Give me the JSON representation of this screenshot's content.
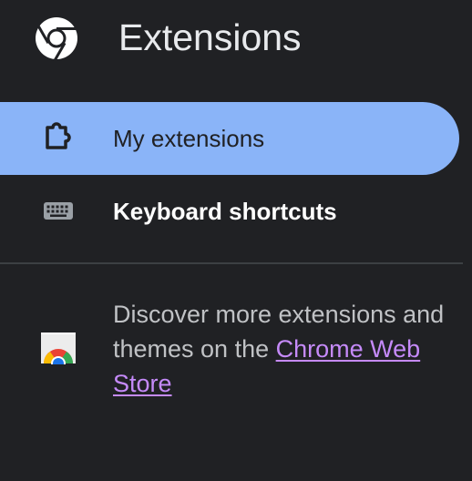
{
  "header": {
    "title": "Extensions",
    "logo_icon": "chrome-logo-icon"
  },
  "sidebar": {
    "items": [
      {
        "label": "My extensions",
        "icon": "puzzle-piece-icon",
        "active": true
      },
      {
        "label": "Keyboard shortcuts",
        "icon": "keyboard-icon",
        "active": false
      }
    ]
  },
  "promo": {
    "text": "Discover more extensions and themes on the ",
    "link_label": "Chrome Web Store",
    "icon": "chrome-web-store-icon"
  },
  "colors": {
    "background": "#202124",
    "active_item": "#8ab4f8",
    "link": "#c58af9"
  }
}
